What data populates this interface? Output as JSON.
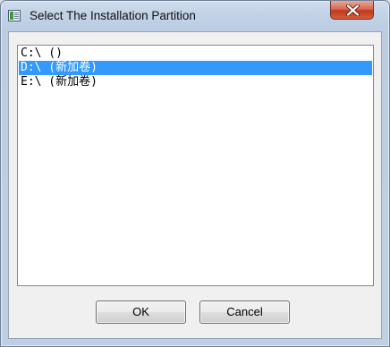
{
  "window": {
    "title": "Select The Installation Partition",
    "close_icon": "close-x-icon",
    "title_icon": "application-icon"
  },
  "partitions": {
    "items": [
      {
        "label": "C:\\ ()",
        "selected": false
      },
      {
        "label": "D:\\ (新加卷)",
        "selected": true
      },
      {
        "label": "E:\\ (新加卷)",
        "selected": false
      }
    ]
  },
  "buttons": {
    "ok_label": "OK",
    "cancel_label": "Cancel"
  },
  "colors": {
    "selection": "#3399ff",
    "close_button": "#c94a30"
  }
}
